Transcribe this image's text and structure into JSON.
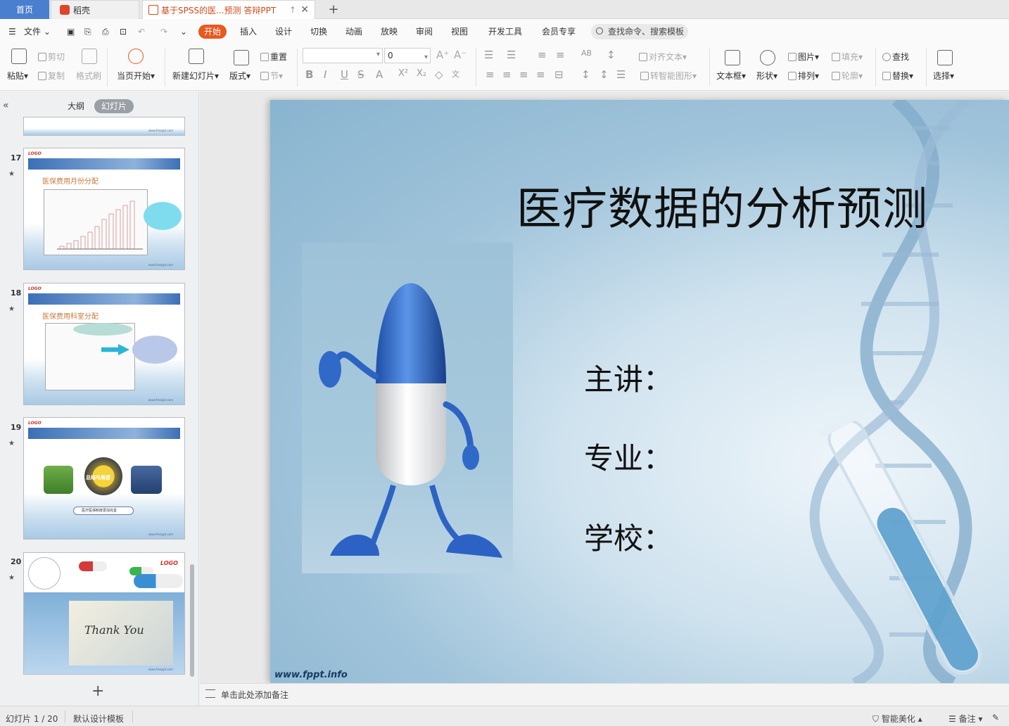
{
  "tabs": {
    "home": "首页",
    "daoke": "稻壳",
    "document": "基于SPSS的医...预测 答辩PPT"
  },
  "menu": {
    "file": "文件",
    "items": [
      "开始",
      "插入",
      "设计",
      "切换",
      "动画",
      "放映",
      "审阅",
      "视图",
      "开发工具",
      "会员专享"
    ],
    "search_placeholder": "查找命令、搜索模板"
  },
  "ribbon": {
    "paste": "粘贴",
    "cut": "剪切",
    "copy": "复制",
    "format_painter": "格式刷",
    "from_current": "当页开始",
    "new_slide": "新建幻灯片",
    "layout": "版式",
    "reset": "重置",
    "section": "节",
    "font_name": "",
    "font_size": "0",
    "align_text": "对齐文本",
    "smart_shape": "转智能图形",
    "textbox": "文本框",
    "shape": "形状",
    "picture": "图片",
    "fill": "填充",
    "arrange": "排列",
    "outline": "轮廓",
    "find": "查找",
    "replace": "替换",
    "select": "选择"
  },
  "panel": {
    "outline_tab": "大纲",
    "slides_tab": "幻灯片",
    "thumbnails": [
      {
        "num": "17",
        "title": "医保费用月份分配",
        "logo": "LOGO"
      },
      {
        "num": "18",
        "title": "医保费用科室分配",
        "logo": "LOGO"
      },
      {
        "num": "19",
        "title": "总结与展望",
        "logo": "LOGO",
        "caption": "医疗医保制度更加完善"
      },
      {
        "num": "20",
        "title": "Thank You",
        "logo": "LOGO"
      }
    ],
    "thumb_url": "www.freeppt.com"
  },
  "slide": {
    "title": "医疗数据的分析预测",
    "presenter": "主讲：",
    "major": "专业：",
    "school": "学校：",
    "watermark": "www.fppt.info"
  },
  "notes": {
    "placeholder": "单击此处添加备注"
  },
  "status": {
    "slide_counter": "幻灯片 1 / 20",
    "template": "默认设计模板",
    "beautify": "智能美化",
    "notes": "备注"
  }
}
